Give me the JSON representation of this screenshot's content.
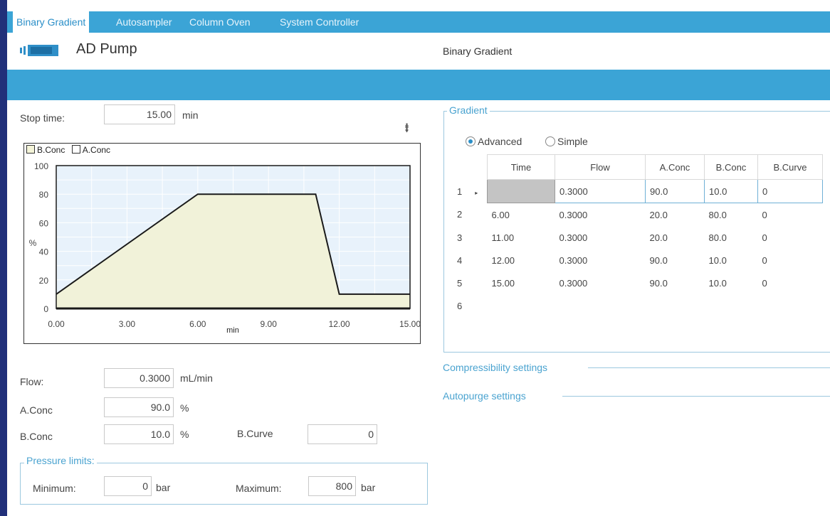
{
  "tabs": [
    "Binary Gradient",
    "Autosampler",
    "Column Oven",
    "System Controller"
  ],
  "header": {
    "title": "AD Pump",
    "right_label": "Binary Gradient",
    "icon": "pump-icon"
  },
  "stop_time": {
    "label": "Stop time:",
    "value": "15.00",
    "unit": "min"
  },
  "collapse_icon": "double-chevron-up",
  "chart_data": {
    "type": "area",
    "legend": [
      "B.Conc",
      "A.Conc"
    ],
    "x": [
      0,
      6,
      11,
      12,
      15
    ],
    "series": [
      {
        "name": "B.Conc",
        "values": [
          10,
          80,
          80,
          10,
          10
        ]
      }
    ],
    "xlim": [
      0,
      15
    ],
    "ylim": [
      0,
      100
    ],
    "x_ticks": [
      "0.00",
      "3.00",
      "6.00",
      "9.00",
      "12.00",
      "15.00"
    ],
    "y_ticks": [
      "0",
      "20",
      "40",
      "60",
      "80",
      "100"
    ],
    "xlabel": "min",
    "ylabel": "%",
    "grid": true,
    "colors": {
      "fill": "#f1f2d9",
      "plot_bg": "#e8f2fb",
      "line": "#1a1a1a"
    }
  },
  "flow": {
    "label": "Flow:",
    "value": "0.3000",
    "unit": "mL/min"
  },
  "a_conc": {
    "label": "A.Conc",
    "value": "90.0",
    "unit": "%"
  },
  "b_conc": {
    "label": "B.Conc",
    "value": "10.0",
    "unit": "%"
  },
  "b_curve": {
    "label": "B.Curve",
    "value": "0"
  },
  "pressure": {
    "title": "Pressure limits:",
    "min_label": "Minimum:",
    "min_value": "0",
    "min_unit": "bar",
    "max_label": "Maximum:",
    "max_value": "800",
    "max_unit": "bar"
  },
  "gradient": {
    "title": "Gradient",
    "modes": [
      "Advanced",
      "Simple"
    ],
    "selected_mode": "Advanced",
    "columns": [
      "Time",
      "Flow",
      "A.Conc",
      "B.Conc",
      "B.Curve"
    ],
    "rows": [
      {
        "n": "1",
        "time": "",
        "flow": "0.3000",
        "a": "90.0",
        "b": "10.0",
        "curve": "0"
      },
      {
        "n": "2",
        "time": "6.00",
        "flow": "0.3000",
        "a": "20.0",
        "b": "80.0",
        "curve": "0"
      },
      {
        "n": "3",
        "time": "11.00",
        "flow": "0.3000",
        "a": "20.0",
        "b": "80.0",
        "curve": "0"
      },
      {
        "n": "4",
        "time": "12.00",
        "flow": "0.3000",
        "a": "90.0",
        "b": "10.0",
        "curve": "0"
      },
      {
        "n": "5",
        "time": "15.00",
        "flow": "0.3000",
        "a": "90.0",
        "b": "10.0",
        "curve": "0"
      },
      {
        "n": "6",
        "time": "",
        "flow": "",
        "a": "",
        "b": "",
        "curve": ""
      }
    ]
  },
  "sections": {
    "compressibility": "Compressibility settings",
    "autopurge": "Autopurge settings"
  },
  "colors": {
    "accent": "#3ba4d6",
    "frame": "#21307a",
    "group_title": "#4aa3d0"
  }
}
